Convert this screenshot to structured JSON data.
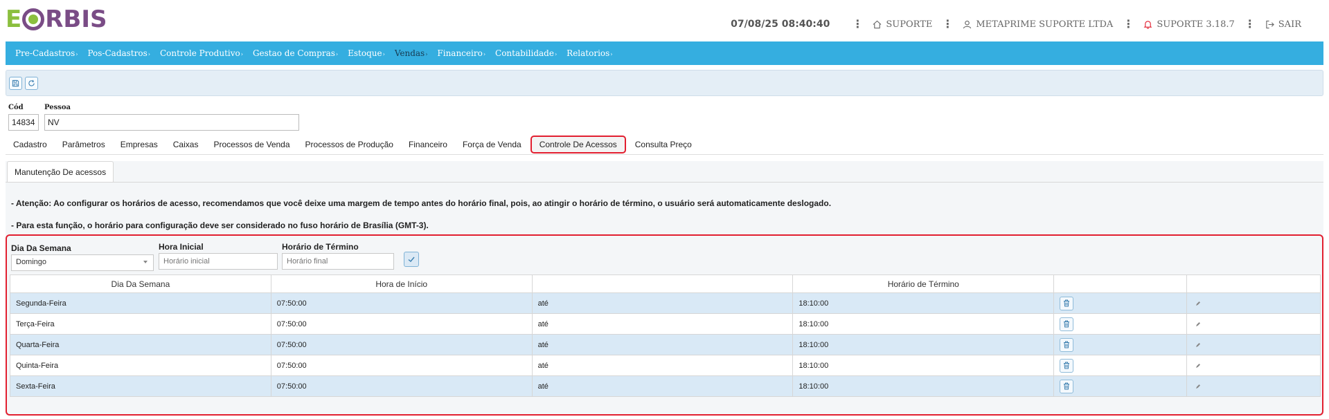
{
  "brand": {
    "logo_left": "E",
    "logo_right": "RBIS"
  },
  "header": {
    "datetime": "07/08/25 08:40:40",
    "support": "SUPORTE",
    "company": "METAPRIME SUPORTE LTDA",
    "version": "SUPORTE 3.18.7",
    "logout": "SAIR"
  },
  "nav": {
    "items": [
      {
        "label": "Pre-Cadastros"
      },
      {
        "label": "Pos-Cadastros"
      },
      {
        "label": "Controle Produtivo"
      },
      {
        "label": "Gestao de Compras"
      },
      {
        "label": "Estoque"
      },
      {
        "label": "Vendas"
      },
      {
        "label": "Financeiro"
      },
      {
        "label": "Contabilidade"
      },
      {
        "label": "Relatorios"
      }
    ],
    "arrow": "›"
  },
  "form": {
    "cod_label": "Cód",
    "cod_value": "14834",
    "pessoa_label": "Pessoa",
    "pessoa_value": "NV"
  },
  "tabs": [
    "Cadastro",
    "Parâmetros",
    "Empresas",
    "Caixas",
    "Processos de Venda",
    "Processos de Produção",
    "Financeiro",
    "Força de Venda",
    "Controle De Acessos",
    "Consulta Preço"
  ],
  "active_tab": "Controle De Acessos",
  "subtab": "Manutenção De acessos",
  "notices": {
    "first": "- Atenção: Ao configurar os horários de acesso, recomendamos que você deixe uma margem de tempo antes do horário final, pois, ao atingir o horário de término, o usuário será automaticamente deslogado.",
    "second": "- Para esta função, o horário para configuração deve ser considerado no fuso horário de Brasília (GMT-3)."
  },
  "filters": {
    "day_label": "Dia Da Semana",
    "day_value": "Domingo",
    "start_label": "Hora Inicial",
    "start_placeholder": "Horário inicial",
    "end_label": "Horário de Término",
    "end_placeholder": "Horário final"
  },
  "table": {
    "headers": [
      "Dia Da Semana",
      "Hora de Início",
      "",
      "Horário de Término",
      "",
      ""
    ],
    "rows": [
      {
        "day": "Segunda-Feira",
        "start": "07:50:00",
        "sep": "até",
        "end": "18:10:00"
      },
      {
        "day": "Terça-Feira",
        "start": "07:50:00",
        "sep": "até",
        "end": "18:10:00"
      },
      {
        "day": "Quarta-Feira",
        "start": "07:50:00",
        "sep": "até",
        "end": "18:10:00"
      },
      {
        "day": "Quinta-Feira",
        "start": "07:50:00",
        "sep": "até",
        "end": "18:10:00"
      },
      {
        "day": "Sexta-Feira",
        "start": "07:50:00",
        "sep": "até",
        "end": "18:10:00"
      }
    ]
  },
  "colors": {
    "nav_bg": "#35aee0",
    "highlight": "#e21e2f",
    "row_alt": "#d9e9f6"
  },
  "icons": [
    "home-icon",
    "user-icon",
    "bell-icon",
    "logout-icon",
    "save-icon",
    "refresh-icon",
    "check-icon",
    "trash-icon",
    "pencil-icon"
  ]
}
